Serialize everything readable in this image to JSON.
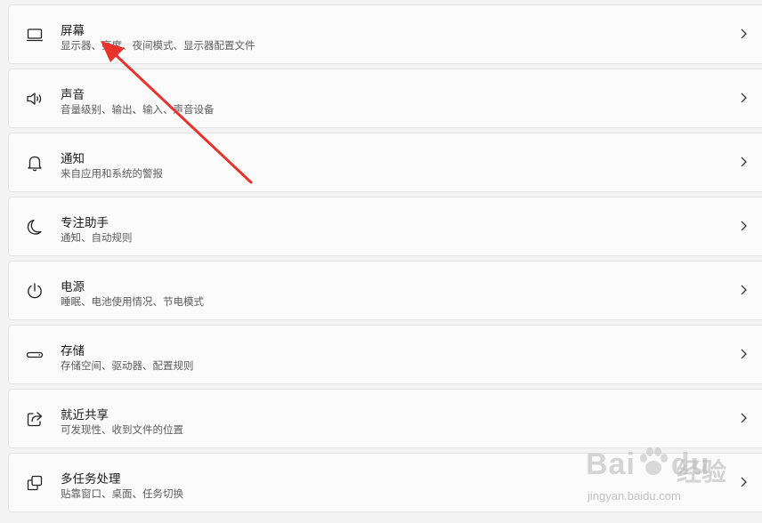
{
  "settings_items": [
    {
      "id": "display",
      "title": "屏幕",
      "subtitle": "显示器、亮度、夜间模式、显示器配置文件",
      "icon": "laptop-icon"
    },
    {
      "id": "sound",
      "title": "声音",
      "subtitle": "音量级别、输出、输入、声音设备",
      "icon": "speaker-icon"
    },
    {
      "id": "notifications",
      "title": "通知",
      "subtitle": "来自应用和系统的警报",
      "icon": "bell-icon"
    },
    {
      "id": "focus",
      "title": "专注助手",
      "subtitle": "通知、自动规则",
      "icon": "moon-icon"
    },
    {
      "id": "power",
      "title": "电源",
      "subtitle": "睡眠、电池使用情况、节电模式",
      "icon": "power-icon"
    },
    {
      "id": "storage",
      "title": "存储",
      "subtitle": "存储空间、驱动器、配置规则",
      "icon": "drive-icon"
    },
    {
      "id": "nearby",
      "title": "就近共享",
      "subtitle": "可发现性、收到文件的位置",
      "icon": "share-icon"
    },
    {
      "id": "multitasking",
      "title": "多任务处理",
      "subtitle": "贴靠窗口、桌面、任务切换",
      "icon": "windows-stack-icon"
    }
  ],
  "annotation": {
    "arrow_color": "#e8322b"
  },
  "watermark": {
    "brand": "Bai",
    "brand_suffix": "du",
    "cn": "经验",
    "url": "jingyan.baidu.com"
  }
}
